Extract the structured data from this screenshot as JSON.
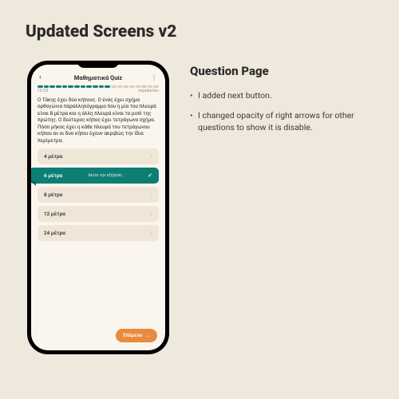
{
  "page": {
    "title": "Updated Screens v2"
  },
  "quiz": {
    "header_title": "Μαθηματικά Quiz",
    "counter": "12/20",
    "skip_label": "παραλείπω",
    "question_text": "Ο Τάκης έχει δύο κήπους. Ο ένας έχει σχήμα ορθογώνιο παραλληλόγραμμο που η μία του πλευρά είναι 8 μέτρα και η άλλη πλευρά είναι το μισό της πρώτης. Ο δεύτερος κήπος έχει τετράγωνο σχήμα. Πόσο μήκος έχει η κάθε πλευρά του τετράγωνου κήπου αν οι δυο κήποι έχουν ακριβώς την ίδια περίμετρο;",
    "options": [
      {
        "label": "4 μέτρα",
        "selected": false
      },
      {
        "label": "6 μέτρα",
        "selected": true,
        "sub": "Δείτε την εξήγηση"
      },
      {
        "label": "8 μέτρα",
        "selected": false
      },
      {
        "label": "12 μέτρα",
        "selected": false
      },
      {
        "label": "24 μέτρα",
        "selected": false
      }
    ],
    "next_label": "Επόμενο"
  },
  "notes": {
    "heading": "Question Page",
    "bullets": [
      "I added next button.",
      "I changed opacity of right arrows for other questions to show it is disable."
    ]
  },
  "colors": {
    "bg": "#efe8dd",
    "screen_bg": "#faf5ed",
    "teal": "#0d7e74",
    "orange": "#e98a3f",
    "option_bg": "#f0e6d8"
  }
}
